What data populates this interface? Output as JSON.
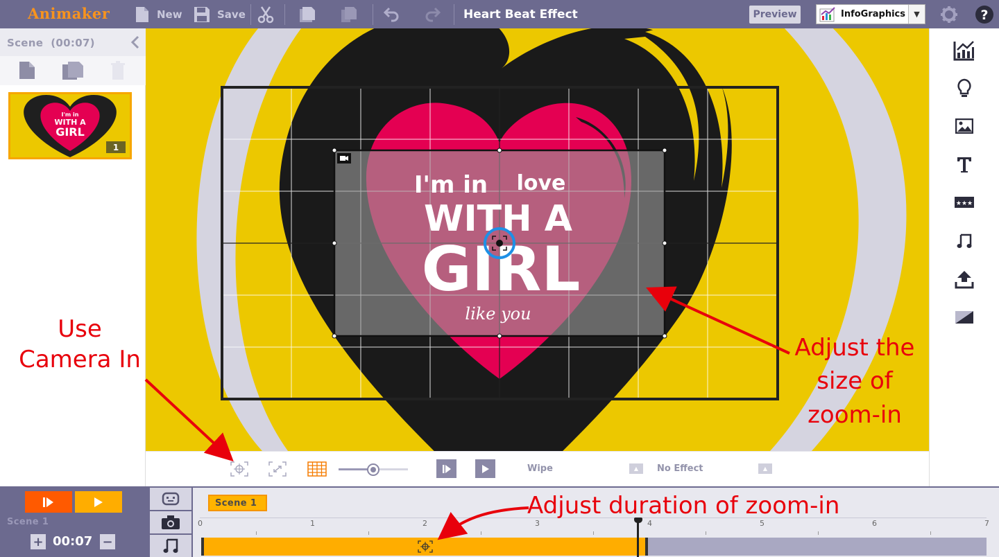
{
  "app": {
    "logo": "Animaker",
    "project_title": "Heart Beat Effect"
  },
  "toolbar": {
    "new_label": "New",
    "save_label": "Save",
    "preview_label": "Preview",
    "category": "InfoGraphics"
  },
  "scene_panel": {
    "title": "Scene",
    "duration": "(00:07)",
    "thumb_number": "1"
  },
  "artwork": {
    "line1a": "I'm in",
    "line1b": "love",
    "line2": "WITH A",
    "line3": "GIRL",
    "line4": "like you"
  },
  "canvas_toolbar": {
    "transition": "Wipe",
    "effect": "No Effect",
    "zoom_level": 0.5
  },
  "timeline": {
    "scene_label": "Scene 1",
    "time": "00:07",
    "chip_label": "Scene 1",
    "ticks": [
      "0",
      "1",
      "2",
      "3",
      "4",
      "5",
      "6",
      "7"
    ],
    "plus": "+",
    "minus": "−"
  },
  "annotations": {
    "use_camera_line1": "Use",
    "use_camera_line2": "Camera In",
    "adjust_size_line1": "Adjust the",
    "adjust_size_line2": "size of",
    "adjust_size_line3": "zoom-in",
    "adjust_duration": "Adjust duration of zoom-in"
  },
  "colors": {
    "topbar": "#6c6a8f",
    "logo": "#f7931e",
    "stage_yellow": "#ecc800",
    "heart_pink": "#e40052",
    "annotation_red": "#e8000b",
    "timeline_bar": "#ffad00"
  }
}
